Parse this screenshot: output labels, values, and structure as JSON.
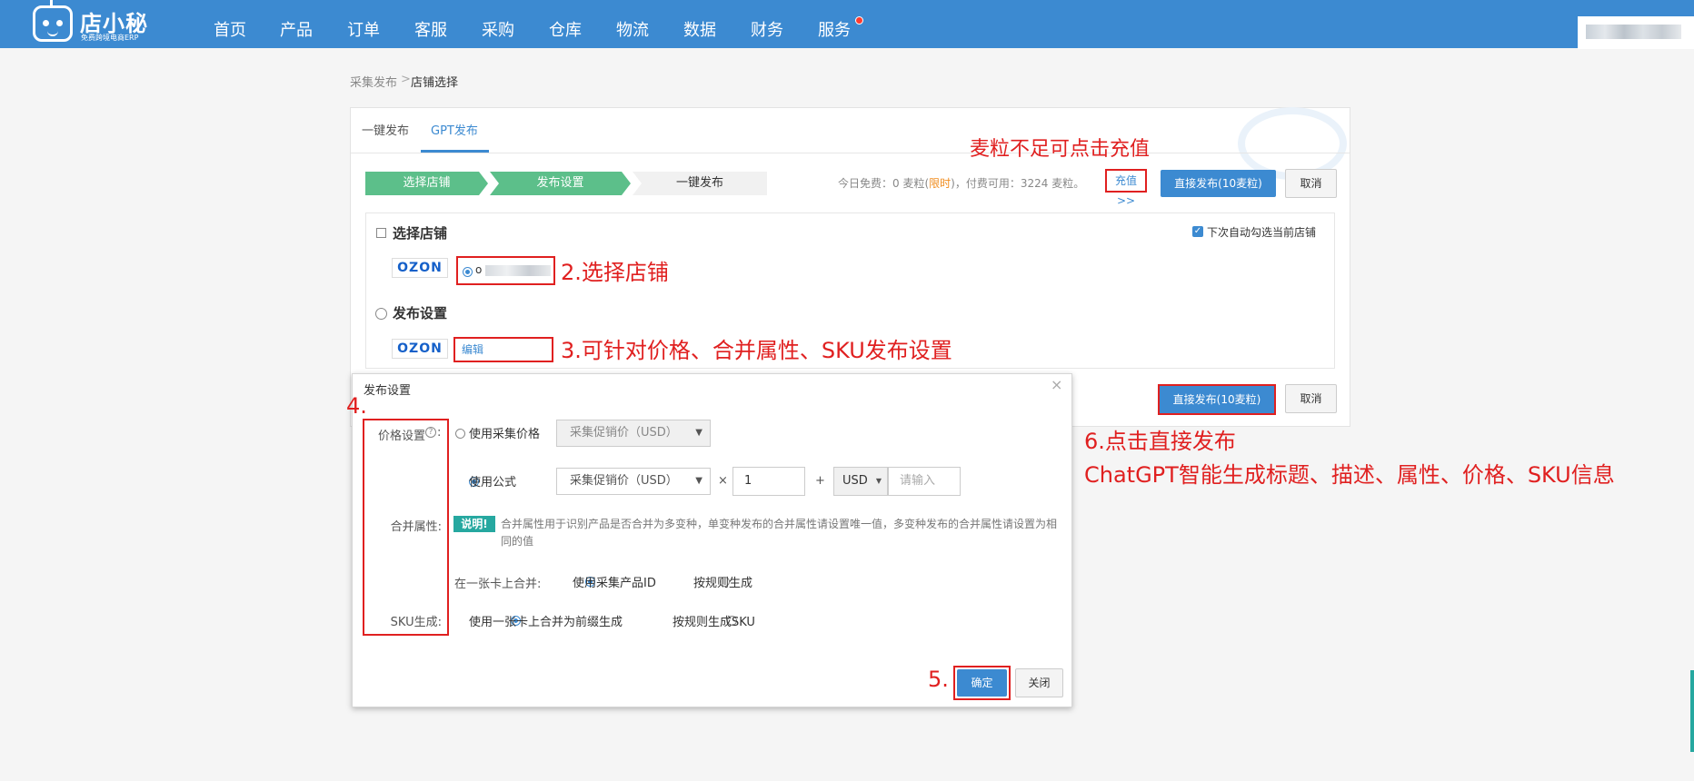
{
  "brand": {
    "name": "店小秘",
    "tagline": "免费跨境电商ERP"
  },
  "nav": {
    "items": [
      "首页",
      "产品",
      "订单",
      "客服",
      "采购",
      "仓库",
      "物流",
      "数据",
      "财务",
      "服务"
    ]
  },
  "breadcrumb": {
    "parent": "采集发布",
    "separator": ">",
    "current": "店铺选择"
  },
  "tabs": [
    "一键发布",
    "GPT发布"
  ],
  "active_tab": "GPT发布",
  "steps": [
    "选择店铺",
    "发布设置",
    "一键发布"
  ],
  "fee": {
    "prefix": "今日免费：0 麦粒(",
    "limited": "限时",
    "suffix": ")，付费可用：3224 麦粒。",
    "recharge": "充值>>"
  },
  "buttons": {
    "publish": "直接发布(10麦粒)",
    "cancel": "取消",
    "confirm": "确定",
    "close": "关闭"
  },
  "auto_check_label": "下次自动勾选当前店铺",
  "section_store": {
    "title": "选择店铺",
    "platform": "OZON",
    "store_name": "o"
  },
  "section_publish": {
    "title": "发布设置",
    "platform": "OZON",
    "edit_link": "编辑"
  },
  "dialog": {
    "title": "发布设置",
    "close_icon": "×",
    "price_label": "价格设置",
    "price_option1": "使用采集价格",
    "price_option2": "使用公式",
    "price_select_disabled": "采集促销价（USD）",
    "price_select": "采集促销价（USD）",
    "multiply": "×",
    "multiplier": "1",
    "plus": "+",
    "currency": "USD",
    "addend_placeholder": "请输入",
    "merge_label": "合并属性:",
    "merge_tag": "说明!",
    "merge_desc": "合并属性用于识别产品是否合并为多变种，单变种发布的合并属性请设置唯一值，多变种发布的合并属性请设置为相同的值",
    "merge_on_card_label": "在一张卡上合并:",
    "merge_opt1": "使用采集产品ID",
    "merge_opt2": "按规则生成",
    "sku_label": "SKU生成:",
    "sku_opt1": "使用一张卡上合并为前缀生成",
    "sku_opt2": "按规则生成SKU"
  },
  "annotations": {
    "recharge": "麦粒不足可点击充值",
    "store": "2.选择店铺",
    "publish_settings": "3.可针对价格、合并属性、SKU发布设置",
    "step4": "4.",
    "step5": "5.",
    "step6_line1": "6.点击直接发布",
    "step6_line2": "ChatGPT智能生成标题、描述、属性、价格、SKU信息"
  },
  "colors": {
    "nav": "#3c8ad1",
    "step_done": "#5cbf8a",
    "annotation": "#e02020",
    "accent": "#3c8ad1"
  }
}
